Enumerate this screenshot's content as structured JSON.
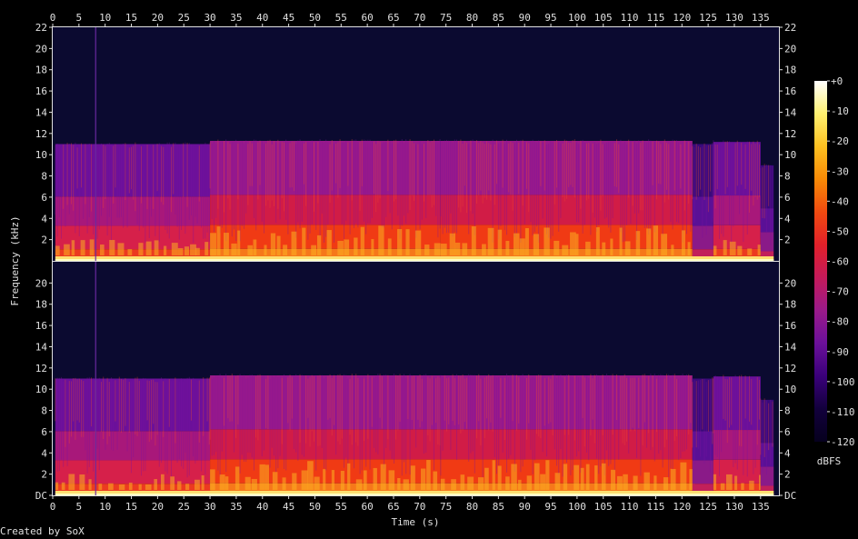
{
  "chart_data": {
    "type": "heatmap",
    "xlabel": "Time (s)",
    "ylabel": "Frequency (kHz)",
    "x_ticks": [
      "0",
      "5",
      "10",
      "15",
      "20",
      "25",
      "30",
      "35",
      "40",
      "45",
      "50",
      "55",
      "60",
      "65",
      "70",
      "75",
      "80",
      "85",
      "90",
      "95",
      "100",
      "105",
      "110",
      "115",
      "120",
      "125",
      "130",
      "135"
    ],
    "xlim": [
      0,
      138.5
    ],
    "channels": [
      {
        "y_ticks": [
          "2",
          "4",
          "6",
          "8",
          "10",
          "12",
          "14",
          "16",
          "18",
          "20",
          "22"
        ]
      },
      {
        "y_ticks": [
          "DC",
          "2",
          "4",
          "6",
          "8",
          "10",
          "12",
          "14",
          "16",
          "18",
          "20"
        ]
      }
    ],
    "ylim": [
      0,
      22
    ],
    "colorbar": {
      "label": "dBFS",
      "ticks": [
        "+0",
        "-10",
        "-20",
        "-30",
        "-40",
        "-50",
        "-60",
        "-70",
        "-80",
        "-90",
        "-100",
        "-110",
        "-120"
      ],
      "range": [
        -120,
        0
      ],
      "colors": [
        "#06001e",
        "#12003c",
        "#3a007a",
        "#6b109a",
        "#9a1a8a",
        "#c41a5a",
        "#e2202a",
        "#f04a10",
        "#f88a06",
        "#fcc020",
        "#fef070",
        "#ffffff"
      ]
    },
    "segments": [
      {
        "t_start": 0.5,
        "t_end": 30,
        "cutoff_khz": 11,
        "level": "medium"
      },
      {
        "t_start": 30,
        "t_end": 74,
        "cutoff_khz": 11.3,
        "level": "high"
      },
      {
        "t_start": 74,
        "t_end": 122,
        "cutoff_khz": 11.3,
        "level": "high"
      },
      {
        "t_start": 122,
        "t_end": 126,
        "cutoff_khz": 11,
        "level": "low"
      },
      {
        "t_start": 126,
        "t_end": 135,
        "cutoff_khz": 11.2,
        "level": "medium"
      },
      {
        "t_start": 135,
        "t_end": 137.5,
        "cutoff_khz": 9,
        "level": "low"
      }
    ]
  },
  "credit": "Created by SoX"
}
